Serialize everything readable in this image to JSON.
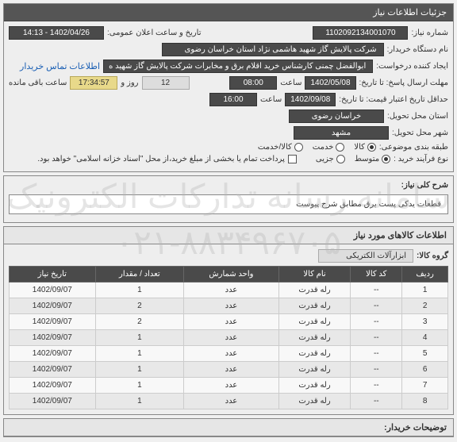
{
  "watermark_line1": "سامانه رسانه تدارکات الکترونیک",
  "watermark_line2": "۰۲۱-۸۸۳۴۹۶۷۰۵",
  "header": {
    "title": "جزئیات اطلاعات نیاز"
  },
  "fields": {
    "need_no_label": "شماره نیاز:",
    "need_no": "1102092134001070",
    "pub_date_label": "تاریخ و ساعت اعلان عمومی:",
    "pub_date": "1402/04/26 - 14:13",
    "buyer_label": "نام دستگاه خریدار:",
    "buyer": "شرکت پالایش گاز شهید هاشمی نژاد   استان خراسان رضوی",
    "requester_label": "ایجاد کننده درخواست:",
    "requester": "ابوالفضل چمنی کارشناس خرید اقلام برق و مخابرات شرکت پالایش گاز شهید ه",
    "contact_link": "اطلاعات تماس خریدار",
    "resp_deadline_label": "مهلت ارسال پاسخ: تا تاریخ:",
    "resp_date": "1402/05/08",
    "time_label": "ساعت",
    "resp_time": "08:00",
    "remain_days": "12",
    "days_and": "روز و",
    "countdown": "17:34:57",
    "remain_text": "ساعت باقی مانده",
    "valid_label": "حداقل تاریخ اعتبار قیمت: تا تاریخ:",
    "valid_date": "1402/09/08",
    "valid_time": "16:00",
    "province_label": "استان محل تحویل:",
    "province": "خراسان رضوی",
    "city_label": "شهر محل تحویل:",
    "city": "مشهد",
    "budget_label": "طبقه بندی موضوعی:",
    "budget_goods": "کالا",
    "budget_service": "خدمت",
    "budget_both": "کالا/خدمت",
    "buy_type_label": "نوع فرآیند خرید :",
    "buy_small": "متوسط",
    "buy_partial": "جزیی",
    "pay_note": "پرداخت تمام یا بخشی از مبلغ خرید،از محل \"اسناد خزانه اسلامی\" خواهد بود."
  },
  "desc": {
    "label": "شرح کلی نیاز:",
    "text": "قطعات یدکی پست برق مطابق شرح پیوست"
  },
  "items": {
    "section_title": "اطلاعات کالاهای مورد نیاز",
    "group_label": "گروه کالا:",
    "group_value": "ابزارآلات الکتریکی",
    "headers": {
      "row": "ردیف",
      "code": "کد کالا",
      "name": "نام کالا",
      "unit": "واحد شمارش",
      "qty": "تعداد / مقدار",
      "date": "تاریخ نیاز"
    },
    "rows": [
      {
        "row": "1",
        "code": "--",
        "name": "رله قدرت",
        "unit": "عدد",
        "qty": "1",
        "date": "1402/09/07"
      },
      {
        "row": "2",
        "code": "--",
        "name": "رله قدرت",
        "unit": "عدد",
        "qty": "2",
        "date": "1402/09/07"
      },
      {
        "row": "3",
        "code": "--",
        "name": "رله قدرت",
        "unit": "عدد",
        "qty": "2",
        "date": "1402/09/07"
      },
      {
        "row": "4",
        "code": "--",
        "name": "رله قدرت",
        "unit": "عدد",
        "qty": "1",
        "date": "1402/09/07"
      },
      {
        "row": "5",
        "code": "--",
        "name": "رله قدرت",
        "unit": "عدد",
        "qty": "1",
        "date": "1402/09/07"
      },
      {
        "row": "6",
        "code": "--",
        "name": "رله قدرت",
        "unit": "عدد",
        "qty": "1",
        "date": "1402/09/07"
      },
      {
        "row": "7",
        "code": "--",
        "name": "رله قدرت",
        "unit": "عدد",
        "qty": "1",
        "date": "1402/09/07"
      },
      {
        "row": "8",
        "code": "--",
        "name": "رله قدرت",
        "unit": "عدد",
        "qty": "1",
        "date": "1402/09/07"
      }
    ]
  },
  "footer": {
    "buyer_notes_label": "توضیحات خریدار:"
  }
}
